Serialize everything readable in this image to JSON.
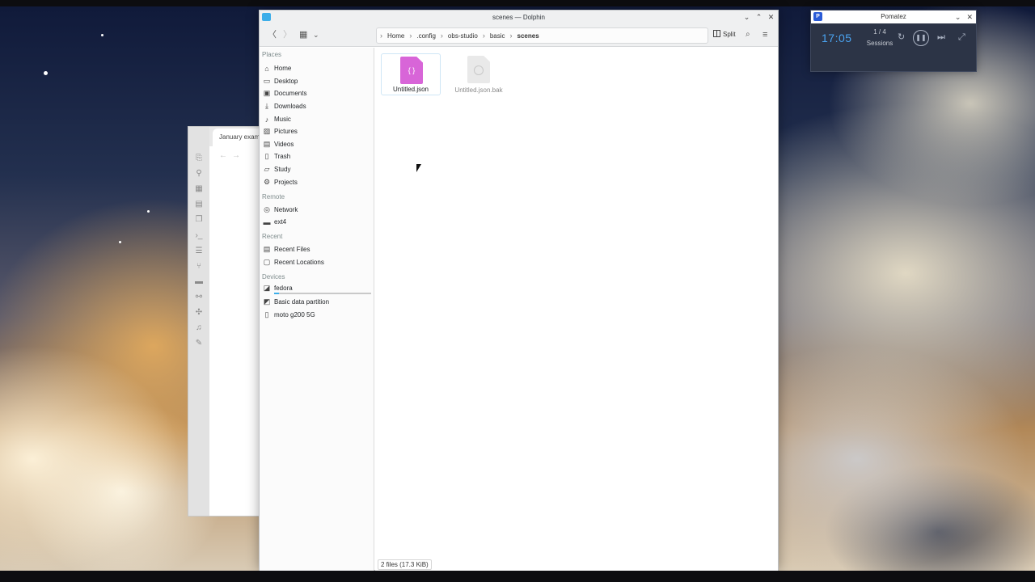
{
  "dolphin": {
    "title": "scenes — Dolphin",
    "breadcrumb": [
      "Home",
      ".config",
      "obs-studio",
      "basic",
      "scenes"
    ],
    "split_label": "Split",
    "places": {
      "places_label": "Places",
      "places_items": [
        {
          "label": "Home",
          "icon": "home-icon"
        },
        {
          "label": "Desktop",
          "icon": "desktop-icon"
        },
        {
          "label": "Documents",
          "icon": "documents-icon"
        },
        {
          "label": "Downloads",
          "icon": "downloads-icon"
        },
        {
          "label": "Music",
          "icon": "music-icon"
        },
        {
          "label": "Pictures",
          "icon": "pictures-icon"
        },
        {
          "label": "Videos",
          "icon": "videos-icon"
        },
        {
          "label": "Trash",
          "icon": "trash-icon"
        },
        {
          "label": "Study",
          "icon": "folder-icon"
        },
        {
          "label": "Projects",
          "icon": "projects-icon"
        }
      ],
      "remote_label": "Remote",
      "remote_items": [
        {
          "label": "Network",
          "icon": "network-icon"
        },
        {
          "label": "ext4",
          "icon": "drive-icon"
        }
      ],
      "recent_label": "Recent",
      "recent_items": [
        {
          "label": "Recent Files",
          "icon": "recent-files-icon"
        },
        {
          "label": "Recent Locations",
          "icon": "recent-locations-icon"
        }
      ],
      "devices_label": "Devices",
      "devices_items": [
        {
          "label": "fedora",
          "icon": "disk-icon"
        },
        {
          "label": "Basic data partition",
          "icon": "partition-icon"
        },
        {
          "label": "moto g200 5G",
          "icon": "phone-icon"
        }
      ]
    },
    "files": [
      {
        "name": "Untitled.json",
        "type": "json"
      },
      {
        "name": "Untitled.json.bak",
        "type": "bak"
      }
    ],
    "status": "2 files (17.3 KiB)"
  },
  "background_window": {
    "tab_title": "January exam"
  },
  "pomatez": {
    "title": "Pomatez",
    "time": "17:05",
    "session_count": "1 / 4",
    "session_label": "Sessions"
  }
}
